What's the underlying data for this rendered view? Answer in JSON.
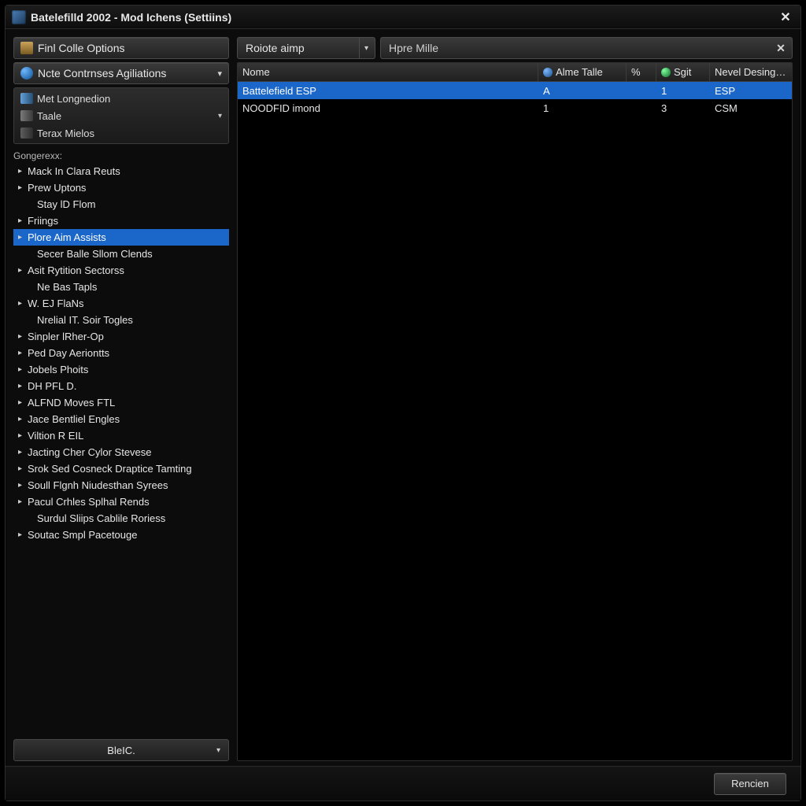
{
  "window": {
    "title": "Batelefilld 2002 - Mod Ichens (Settiins)"
  },
  "sidebar": {
    "find_options_label": "Finl Colle Options",
    "note_controls_label": "Ncte Contrnses Agiliations",
    "nav": [
      {
        "label": "Met Longnedion",
        "icon": "a",
        "chev": false
      },
      {
        "label": "Taale",
        "icon": "b",
        "chev": true
      },
      {
        "label": "Terax Mielos",
        "icon": "c",
        "chev": false
      }
    ],
    "tree_heading": "Gongerexx:",
    "tree": [
      {
        "label": "Mack In Clara Reuts",
        "arrow": true,
        "indent": false,
        "selected": false
      },
      {
        "label": "Prew Uptons",
        "arrow": true,
        "indent": false,
        "selected": false
      },
      {
        "label": "Stay lD Flom",
        "arrow": false,
        "indent": true,
        "selected": false
      },
      {
        "label": "Friings",
        "arrow": true,
        "indent": false,
        "selected": false
      },
      {
        "label": "Plore Aim Assists",
        "arrow": true,
        "indent": false,
        "selected": true
      },
      {
        "label": "Secer Balle Sllom Clends",
        "arrow": false,
        "indent": true,
        "selected": false
      },
      {
        "label": "Asit Rytition Sectorss",
        "arrow": true,
        "indent": false,
        "selected": false
      },
      {
        "label": "Ne Bas Tapls",
        "arrow": false,
        "indent": true,
        "selected": false
      },
      {
        "label": "W. EJ FlaNs",
        "arrow": true,
        "indent": false,
        "selected": false
      },
      {
        "label": "Nrelial IT. Soir Togles",
        "arrow": false,
        "indent": true,
        "selected": false
      },
      {
        "label": "Sinpler lRher-Op",
        "arrow": true,
        "indent": false,
        "selected": false
      },
      {
        "label": "Ped Day Aeriontts",
        "arrow": true,
        "indent": false,
        "selected": false
      },
      {
        "label": "Jobels Phoits",
        "arrow": true,
        "indent": false,
        "selected": false
      },
      {
        "label": "DH PFL D.",
        "arrow": true,
        "indent": false,
        "selected": false
      },
      {
        "label": "ALFND Moves FTL",
        "arrow": true,
        "indent": false,
        "selected": false
      },
      {
        "label": "Jace Bentliel Engles",
        "arrow": true,
        "indent": false,
        "selected": false
      },
      {
        "label": "Viltion R EIL",
        "arrow": true,
        "indent": false,
        "selected": false
      },
      {
        "label": "Jacting Cher Cylor Stevese",
        "arrow": true,
        "indent": false,
        "selected": false
      },
      {
        "label": "Srok Sed Cosneck Draptice Tamting",
        "arrow": true,
        "indent": false,
        "selected": false
      },
      {
        "label": "Soull Flgnh Niudesthan Syrees",
        "arrow": true,
        "indent": false,
        "selected": false
      },
      {
        "label": "Pacul Crhles Splhal Rends",
        "arrow": true,
        "indent": false,
        "selected": false
      },
      {
        "label": "Surdul Sliips Cablile Roriess",
        "arrow": false,
        "indent": true,
        "selected": false
      },
      {
        "label": "Soutac Smpl Pacetouge",
        "arrow": true,
        "indent": false,
        "selected": false
      }
    ],
    "footer_combo_label": "BleIC."
  },
  "main": {
    "combo_label": "Roiote aimp",
    "search_placeholder": "Hpre Mille",
    "columns": {
      "name": "Nome",
      "alme": "Alme Talle",
      "pct": "%",
      "sgit": "Sgit",
      "nevel": "Nevel Desing…"
    },
    "rows": [
      {
        "name": "Battelefield ESP",
        "alme": "A",
        "pct": "",
        "sgit": "1",
        "nevel": "ESP",
        "selected": true
      },
      {
        "name": "NOODFID imond",
        "alme": "1",
        "pct": "",
        "sgit": "3",
        "nevel": "CSM",
        "selected": false
      }
    ]
  },
  "footer": {
    "primary_label": "Rencien"
  }
}
